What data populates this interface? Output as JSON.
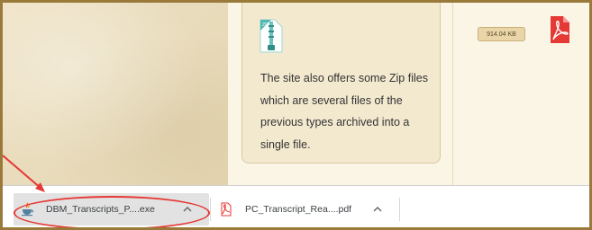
{
  "page": {
    "info_text": "The site also offers some Zip files which are several files of the previous types archived into a single file.",
    "zip_icon": "zip-file-icon",
    "file_size_badge": "914.04 KB",
    "pdf_icon": "pdf-file-icon"
  },
  "download_bar": {
    "items": [
      {
        "name": "DBM_Transcripts_P....exe",
        "icon": "java-installer-icon",
        "chevron": "chevron-up-icon",
        "highlighted": true
      },
      {
        "name": "PC_Transcript_Rea....pdf",
        "icon": "pdf-file-icon",
        "chevron": "chevron-up-icon",
        "highlighted": false
      }
    ]
  },
  "annotations": {
    "highlight_color": "#e53935",
    "arrow_color": "#e53935"
  },
  "colors": {
    "frame_border": "#9a7a3a",
    "card_bg": "#f3e9cf",
    "badge_bg": "#e9d5a8"
  }
}
